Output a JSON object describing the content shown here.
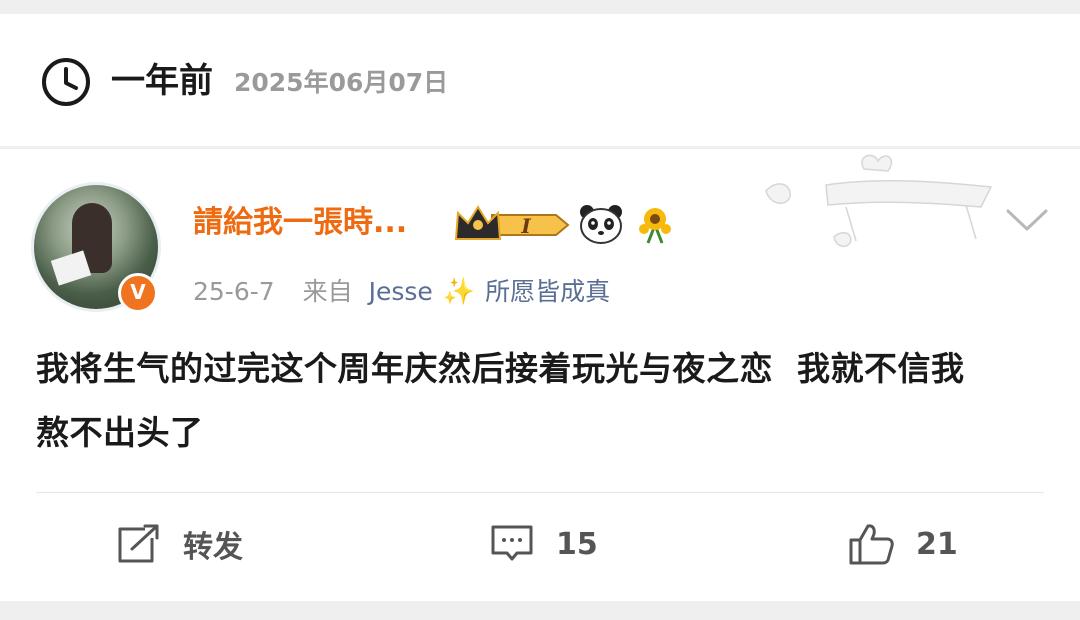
{
  "memory": {
    "ago_label": "一年前",
    "full_date": "2025年06月07日"
  },
  "post": {
    "username": "請給我一張時...",
    "badge_level": "I",
    "time": "25-6-7",
    "from_label": "来自",
    "source": "Jesse",
    "source_suffix": "所愿皆成真",
    "sparkle": "✨",
    "verified_mark": "V",
    "content": "我将生气的过完这个周年庆然后接着玩光与夜之恋  我就不信我\n熬不出头了"
  },
  "actions": {
    "repost_label": "转发",
    "comment_count": "15",
    "like_count": "21"
  },
  "colors": {
    "username": "#ee6b12",
    "source": "#5b6f94",
    "meta_gray": "#9a9a9a",
    "verified": "#f0741f"
  },
  "icons": [
    "clock-icon",
    "crown-icon",
    "panda-icon",
    "sunflower-icon",
    "chevron-down-icon",
    "repost-icon",
    "comment-icon",
    "like-icon"
  ]
}
